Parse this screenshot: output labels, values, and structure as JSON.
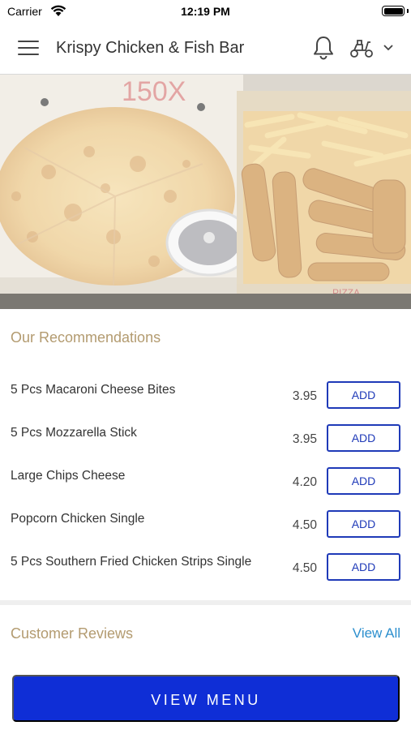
{
  "status_bar": {
    "carrier": "Carrier",
    "time": "12:19 PM"
  },
  "header": {
    "title": "Krispy Chicken & Fish Bar",
    "icons": [
      "menu-icon",
      "bell-icon",
      "scooter-icon",
      "chevron-down-icon"
    ]
  },
  "hero": {
    "sign_text": "150X",
    "box_text": "PIZZA"
  },
  "recommendations": {
    "title": "Our Recommendations",
    "add_label": "ADD",
    "items": [
      {
        "name": "5 Pcs Macaroni Cheese Bites",
        "price": "3.95"
      },
      {
        "name": "5 Pcs Mozzarella Stick",
        "price": "3.95"
      },
      {
        "name": "Large Chips Cheese",
        "price": "4.20"
      },
      {
        "name": "Popcorn Chicken Single",
        "price": "4.50"
      },
      {
        "name": "5 Pcs Southern Fried Chicken Strips Single",
        "price": "4.50"
      }
    ]
  },
  "reviews": {
    "title": "Customer Reviews",
    "view_all": "View All"
  },
  "footer": {
    "view_menu": "VIEW MENU"
  },
  "colors": {
    "accent": "#0f2ed6",
    "button_border": "#1f3ab8",
    "section_title": "#b39b70",
    "link": "#2c8fce"
  }
}
